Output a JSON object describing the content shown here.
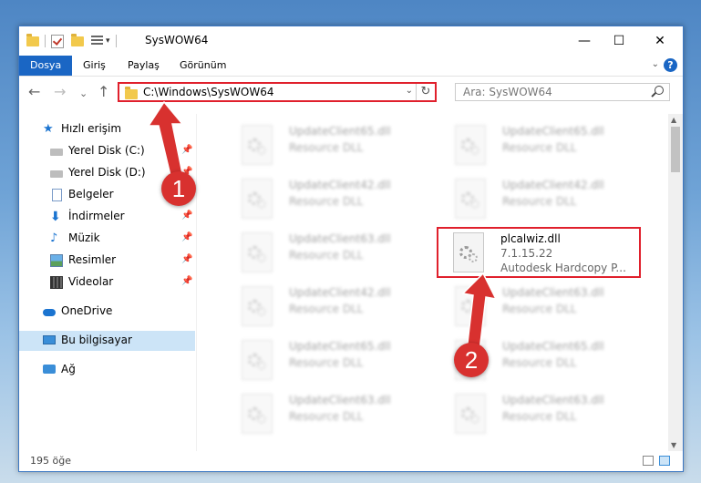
{
  "window": {
    "title": "SysWOW64",
    "controls": {
      "minimize": "—",
      "maximize": "☐",
      "close": "✕"
    }
  },
  "ribbon": {
    "tabs": [
      "Dosya",
      "Giriş",
      "Paylaş",
      "Görünüm"
    ],
    "help": "?",
    "expand": "⌄"
  },
  "navigation": {
    "back": "←",
    "forward": "→",
    "recent": "⌄",
    "up": "↑",
    "address": "C:\\Windows\\SysWOW64",
    "address_drop": "⌄",
    "refresh": "↻",
    "search_placeholder": "Ara: SysWOW64"
  },
  "sidebar": {
    "items": [
      {
        "label": "Hızlı erişim",
        "icon": "star-icon",
        "pinned": false
      },
      {
        "label": "Yerel Disk (C:)",
        "icon": "drive-icon",
        "pinned": true
      },
      {
        "label": "Yerel Disk (D:)",
        "icon": "drive-icon",
        "pinned": true
      },
      {
        "label": "Belgeler",
        "icon": "documents-icon",
        "pinned": true
      },
      {
        "label": "İndirmeler",
        "icon": "downloads-icon",
        "pinned": true
      },
      {
        "label": "Müzik",
        "icon": "music-icon",
        "pinned": true
      },
      {
        "label": "Resimler",
        "icon": "pictures-icon",
        "pinned": true
      },
      {
        "label": "Videolar",
        "icon": "videos-icon",
        "pinned": true
      },
      {
        "label": "OneDrive",
        "icon": "cloud-icon",
        "pinned": false
      },
      {
        "label": "Bu bilgisayar",
        "icon": "computer-icon",
        "pinned": false,
        "selected": true
      },
      {
        "label": "Ağ",
        "icon": "network-icon",
        "pinned": false
      }
    ],
    "pin_glyph": "📌"
  },
  "files": {
    "left_column": [
      {
        "name": "UpdateClient65.dll",
        "type": "Resource DLL"
      },
      {
        "name": "UpdateClient42.dll",
        "type": "Resource DLL"
      },
      {
        "name": "UpdateClient63.dll",
        "type": "Resource DLL"
      },
      {
        "name": "UpdateClient42.dll",
        "type": "Resource DLL"
      },
      {
        "name": "UpdateClient65.dll",
        "type": "Resource DLL"
      },
      {
        "name": "UpdateClient63.dll",
        "type": "Resource DLL"
      }
    ],
    "right_column": [
      {
        "name": "UpdateClient65.dll",
        "type": "Resource DLL"
      },
      {
        "name": "UpdateClient42.dll",
        "type": "Resource DLL"
      },
      {
        "name": "UpdateClient63.dll",
        "type": "Resource DLL"
      },
      {
        "name": "UpdateClient65.dll",
        "type": "Resource DLL"
      },
      {
        "name": "UpdateClient63.dll",
        "type": "Resource DLL"
      }
    ],
    "highlighted": {
      "name": "plcalwiz.dll",
      "version": "7.1.15.22",
      "description": "Autodesk Hardcopy P..."
    }
  },
  "status": {
    "item_count": "195 öğe"
  },
  "annotations": {
    "step1": "1",
    "step2": "2"
  },
  "colors": {
    "accent": "#1a66c4",
    "highlight": "#e0202c",
    "badge": "#d8312f"
  }
}
